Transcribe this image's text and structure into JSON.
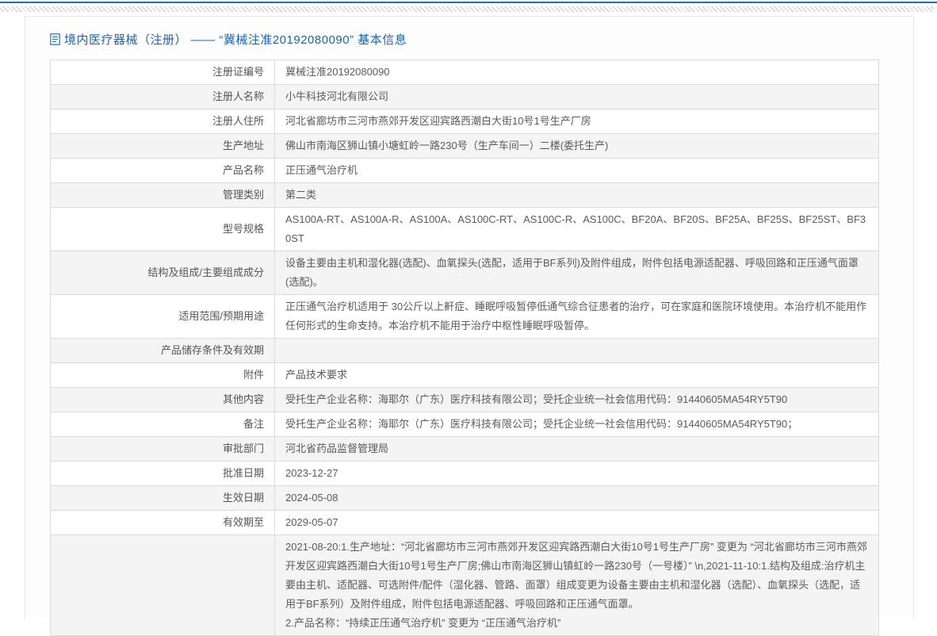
{
  "page": {
    "title": "境内医疗器械（注册） —— “冀械注准20192080090” 基本信息"
  },
  "colors": {
    "top_accent": "#2269c3",
    "title_blue": "#1a65b4",
    "row_alt": "#f4f4f4",
    "border": "#dbdbdb"
  },
  "table": {
    "rows": [
      {
        "label": "注册证编号",
        "value": "冀械注准20192080090"
      },
      {
        "label": "注册人名称",
        "value": "小牛科技河北有限公司"
      },
      {
        "label": "注册人住所",
        "value": "河北省廊坊市三河市燕郊开发区迎宾路西潮白大街10号1号生产厂房"
      },
      {
        "label": "生产地址",
        "value": "佛山市南海区狮山镇小塘虹岭一路230号（生产车间一）二楼(委托生产)"
      },
      {
        "label": "产品名称",
        "value": "正压通气治疗机"
      },
      {
        "label": "管理类别",
        "value": "第二类"
      },
      {
        "label": "型号规格",
        "value": "AS100A-RT、AS100A-R、AS100A、AS100C-RT、AS100C-R、AS100C、BF20A、BF20S、BF25A、BF25S、BF25ST、BF30ST"
      },
      {
        "label": "结构及组成/主要组成成分",
        "value": "设备主要由主机和湿化器(选配)、血氧探头(选配，适用于BF系列)及附件组成，附件包括电源适配器、呼吸回路和正压通气面罩(选配)。"
      },
      {
        "label": "适用范围/预期用途",
        "value": "正压通气治疗机适用于 30公斤以上鼾症、睡眠呼吸暂停低通气综合征患者的治疗，可在家庭和医院环境使用。本治疗机不能用作任何形式的生命支持。本治疗机不能用于治疗中枢性睡眠呼吸暂停。"
      },
      {
        "label": "产品储存条件及有效期",
        "value": ""
      },
      {
        "label": "附件",
        "value": "产品技术要求"
      },
      {
        "label": "其他内容",
        "value": "受托生产企业名称：海耶尔（广东）医疗科技有限公司；受托企业统一社会信用代码：91440605MA54RY5T90"
      },
      {
        "label": "备注",
        "value": "受托生产企业名称：海耶尔（广东）医疗科技有限公司；受托企业统一社会信用代码：91440605MA54RY5T90；"
      },
      {
        "label": "审批部门",
        "value": "河北省药品监督管理局"
      },
      {
        "label": "批准日期",
        "value": "2023-12-27"
      },
      {
        "label": "生效日期",
        "value": "2024-05-08"
      },
      {
        "label": "有效期至",
        "value": "2029-05-07"
      },
      {
        "label": "",
        "value": "2021-08-20:1.生产地址：“河北省廊坊市三河市燕郊开发区迎宾路西潮白大街10号1号生产厂房” 变更为 “河北省廊坊市三河市燕郊开发区迎宾路西潮白大街10号1号生产厂房;佛山市南海区狮山镇虹岭一路230号（一号楼）” \\n,2021-11-10:1.结构及组成:治疗机主要由主机、适配器、可选附件/配件（湿化器、管路、面罩）组成变更为设备主要由主机和湿化器（选配）、血氧探头（选配，适用于BF系列）及附件组成，附件包括电源适配器、呼吸回路和正压通气面罩。\n2.产品名称：“持续正压通气治疗机” 变更为 “正压通气治疗机”"
      }
    ]
  }
}
